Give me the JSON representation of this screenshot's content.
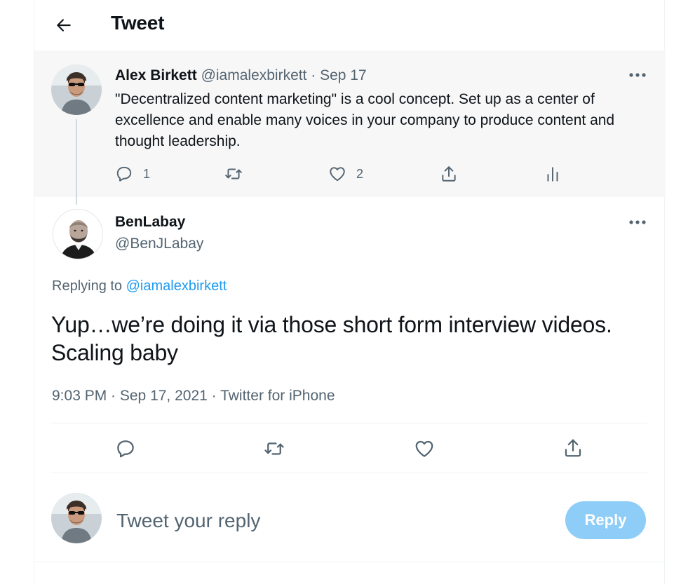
{
  "header": {
    "title": "Tweet",
    "back_icon": "arrow-left-icon"
  },
  "parent_tweet": {
    "author_name": "Alex Birkett",
    "meta": "@iamalexbirkett · Sep 17",
    "text": "\"Decentralized content marketing\" is a cool concept. Set up as a center of excellence and enable many voices in your company to produce content and thought leadership.",
    "reply_count": "1",
    "like_count": "2",
    "icons": [
      "reply-icon",
      "retweet-icon",
      "like-icon",
      "share-icon",
      "analytics-icon"
    ]
  },
  "main_tweet": {
    "author_name": "BenLabay",
    "author_handle": "@BenJLabay",
    "replying_prefix": "Replying to",
    "replying_to": "@iamalexbirkett",
    "text": "Yup…we’re doing it via those short form interview videos. Scaling baby",
    "timestamp": "9:03 PM · Sep 17, 2021 · Twitter for iPhone",
    "icons": [
      "reply-icon",
      "retweet-icon",
      "like-icon",
      "share-icon"
    ]
  },
  "composer": {
    "placeholder": "Tweet your reply",
    "reply_label": "Reply"
  },
  "colors": {
    "link": "#1d9bf0",
    "secondary_text": "#536471",
    "reply_button": "#8ecdf8",
    "parent_background": "#f7f7f7"
  }
}
